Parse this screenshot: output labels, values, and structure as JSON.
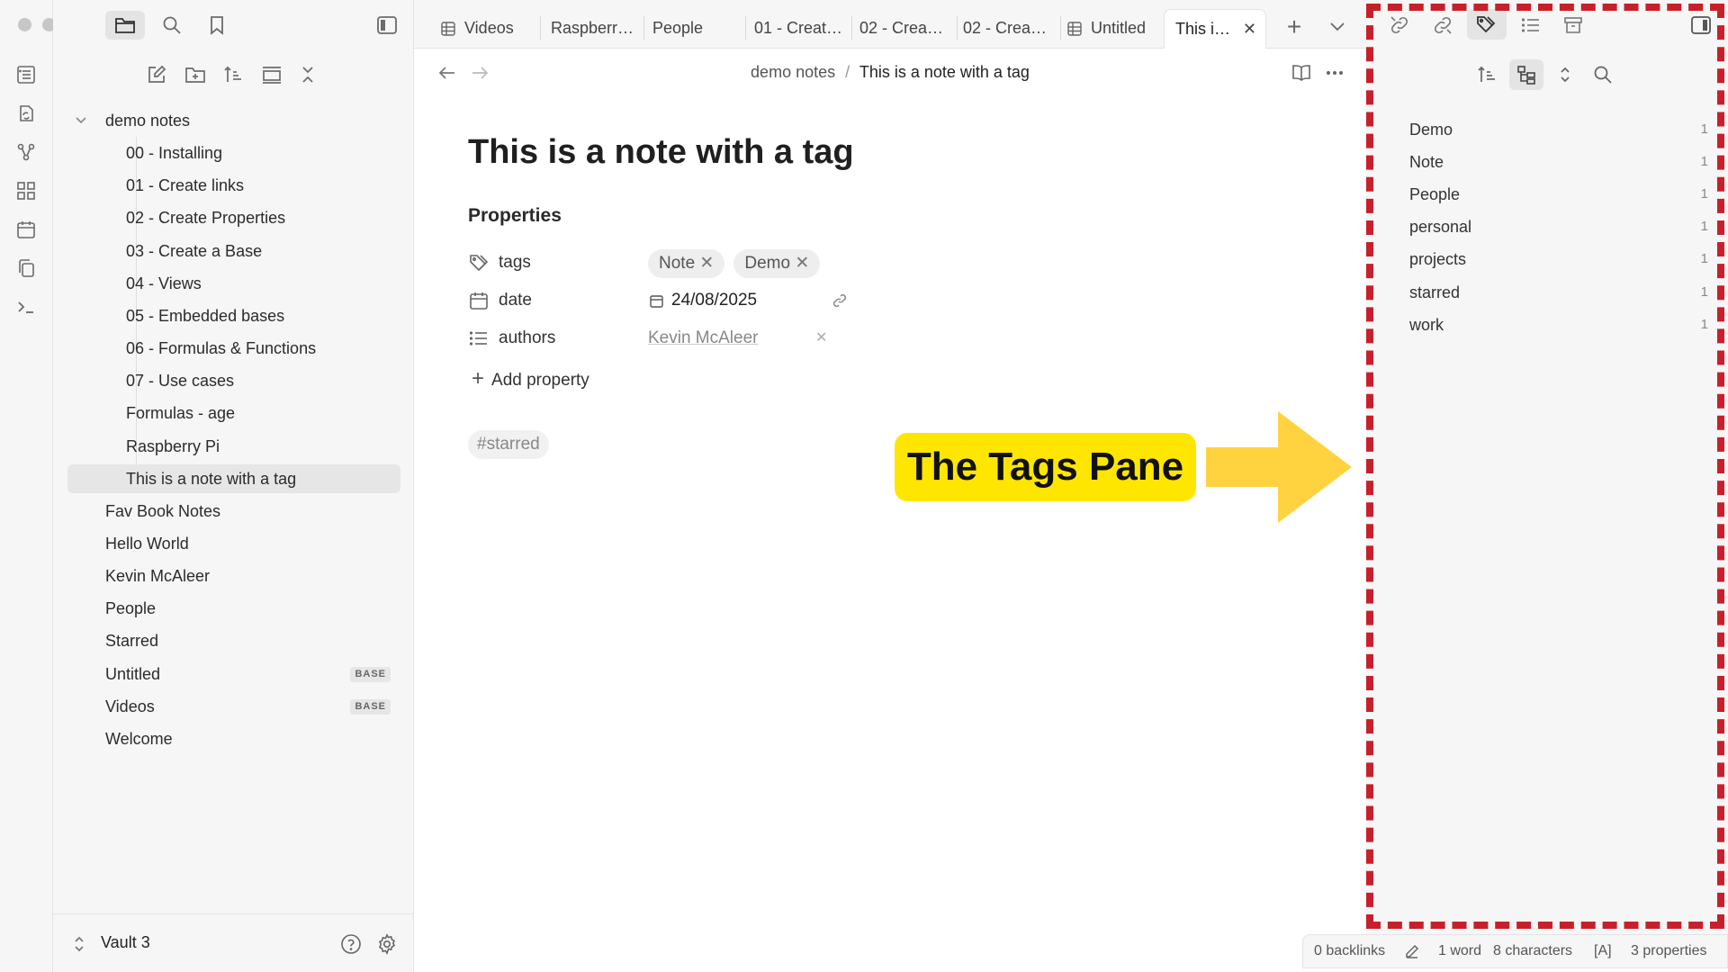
{
  "window": {
    "traffic_lights": [
      "close",
      "minimize",
      "maximize"
    ]
  },
  "ribbon": {
    "icons": [
      "dashboard-icon",
      "note-sync-icon",
      "graph-icon",
      "blocks-icon",
      "calendar-icon",
      "copy-icon",
      "terminal-icon"
    ]
  },
  "sidebar": {
    "tree": [
      {
        "label": "demo notes",
        "type": "folder"
      },
      {
        "label": "00 - Installing"
      },
      {
        "label": "01 - Create links"
      },
      {
        "label": "02 - Create Properties"
      },
      {
        "label": "03 - Create a Base"
      },
      {
        "label": "04 - Views"
      },
      {
        "label": "05 - Embedded bases"
      },
      {
        "label": "06 - Formulas & Functions"
      },
      {
        "label": "07 - Use cases"
      },
      {
        "label": "Formulas - age"
      },
      {
        "label": "Raspberry Pi"
      },
      {
        "label": "This is a note with a tag",
        "active": true
      },
      {
        "label": "Fav Book Notes"
      },
      {
        "label": "Hello World"
      },
      {
        "label": "Kevin McAleer"
      },
      {
        "label": "People"
      },
      {
        "label": "Starred"
      },
      {
        "label": "Untitled",
        "badge": "BASE"
      },
      {
        "label": "Videos",
        "badge": "BASE"
      },
      {
        "label": "Welcome"
      }
    ],
    "vault_name": "Vault 3"
  },
  "tabs": [
    {
      "label": "Videos",
      "icon": "table-icon"
    },
    {
      "label": "Raspberr…"
    },
    {
      "label": "People"
    },
    {
      "label": "01 - Creat…"
    },
    {
      "label": "02 - Crea…"
    },
    {
      "label": "02 - Crea…"
    },
    {
      "label": "Untitled",
      "icon": "table-icon"
    },
    {
      "label": "This i…",
      "active": true,
      "close": "✕"
    }
  ],
  "tabbar": {
    "new_tab": "+"
  },
  "editor": {
    "breadcrumb_folder": "demo notes",
    "breadcrumb_sep": "/",
    "breadcrumb_file": "This is a note with a tag",
    "title": "This is a note with a tag",
    "properties_heading": "Properties",
    "properties": {
      "tags_label": "tags",
      "tags": [
        "Note",
        "Demo"
      ],
      "date_label": "date",
      "date_value": "24/08/2025",
      "authors_label": "authors",
      "authors_value": "Kevin McAleer"
    },
    "add_property": "Add property",
    "body_tag": "#starred"
  },
  "tags_pane": {
    "tags": [
      {
        "name": "Demo",
        "count": "1"
      },
      {
        "name": "Note",
        "count": "1"
      },
      {
        "name": "People",
        "count": "1"
      },
      {
        "name": "personal",
        "count": "1"
      },
      {
        "name": "projects",
        "count": "1"
      },
      {
        "name": "starred",
        "count": "1"
      },
      {
        "name": "work",
        "count": "1"
      }
    ]
  },
  "statusbar": {
    "backlinks": "0 backlinks",
    "words": "1 word",
    "characters": "8 characters",
    "mode": "[A]",
    "properties": "3 properties"
  },
  "annotation": {
    "callout_text": "The Tags Pane",
    "callout_color": "#ffe600",
    "arrow_color": "#ffd23f",
    "border_color": "#c8202a"
  }
}
